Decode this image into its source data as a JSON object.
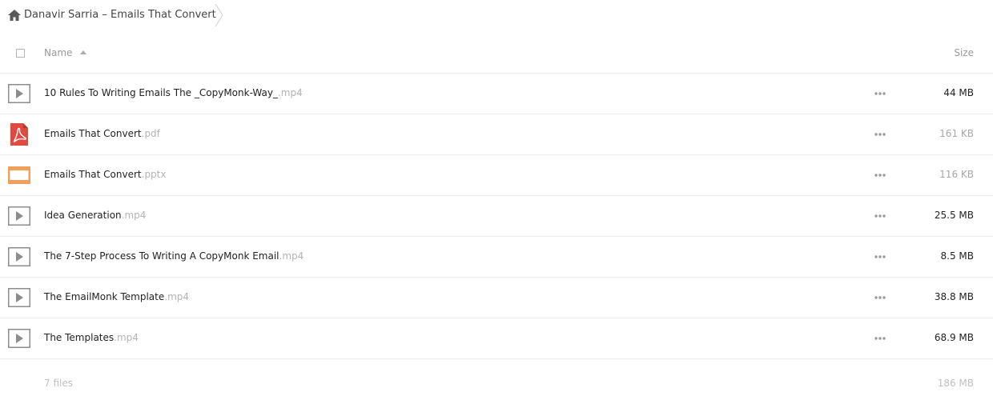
{
  "breadcrumb": {
    "label": "Danavir Sarria – Emails That Convert"
  },
  "header": {
    "name_label": "Name",
    "size_label": "Size"
  },
  "files": [
    {
      "name": "10 Rules To Writing Emails The _CopyMonk-Way_",
      "ext": ".mp4",
      "size": "44 MB",
      "type": "video-icon",
      "size_dark": true
    },
    {
      "name": "Emails That Convert",
      "ext": ".pdf",
      "size": "161 KB",
      "type": "pdf-icon",
      "size_dark": false
    },
    {
      "name": "Emails That Convert",
      "ext": ".pptx",
      "size": "116 KB",
      "type": "presentation-icon",
      "size_dark": false
    },
    {
      "name": "Idea Generation",
      "ext": ".mp4",
      "size": "25.5 MB",
      "type": "video-icon",
      "size_dark": true
    },
    {
      "name": "The 7-Step Process To Writing A CopyMonk Email",
      "ext": ".mp4",
      "size": "8.5 MB",
      "type": "video-icon",
      "size_dark": true
    },
    {
      "name": "The EmailMonk Template",
      "ext": ".mp4",
      "size": "38.8 MB",
      "type": "video-icon",
      "size_dark": true
    },
    {
      "name": "The Templates",
      "ext": ".mp4",
      "size": "68.9 MB",
      "type": "video-icon",
      "size_dark": true
    }
  ],
  "footer": {
    "count": "7 files",
    "total": "186 MB"
  },
  "colors": {
    "pdf": "#e04a3f",
    "pptx": "#f0a05c",
    "video_border": "#8c8c8c"
  }
}
